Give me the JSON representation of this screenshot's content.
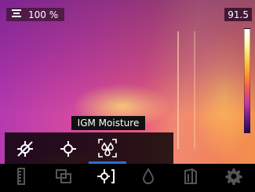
{
  "status": {
    "battery_text": "100 %",
    "battery_level": 1.0,
    "temperature": "91.5"
  },
  "tooltip": {
    "label": "IGM Moisture"
  },
  "submenu": {
    "items": [
      {
        "name": "laser-off",
        "icon": "crossed-crosshair-icon"
      },
      {
        "name": "crosshair",
        "icon": "crosshair-icon"
      },
      {
        "name": "igm-moisture",
        "icon": "moisture-drops-icon",
        "selected": true
      }
    ]
  },
  "toolbar": {
    "items": [
      {
        "name": "ruler",
        "icon": "ruler-icon"
      },
      {
        "name": "image-blend",
        "icon": "overlay-icon"
      },
      {
        "name": "measurement",
        "icon": "crosshair-bracket-icon",
        "active": true
      },
      {
        "name": "humidity",
        "icon": "droplet-icon"
      },
      {
        "name": "emissivity",
        "icon": "surface-icon"
      },
      {
        "name": "settings",
        "icon": "gear-icon"
      }
    ]
  },
  "colors": {
    "accent": "#2a6fd8",
    "icon_inactive": "#555555",
    "icon_active": "#ffffff"
  }
}
